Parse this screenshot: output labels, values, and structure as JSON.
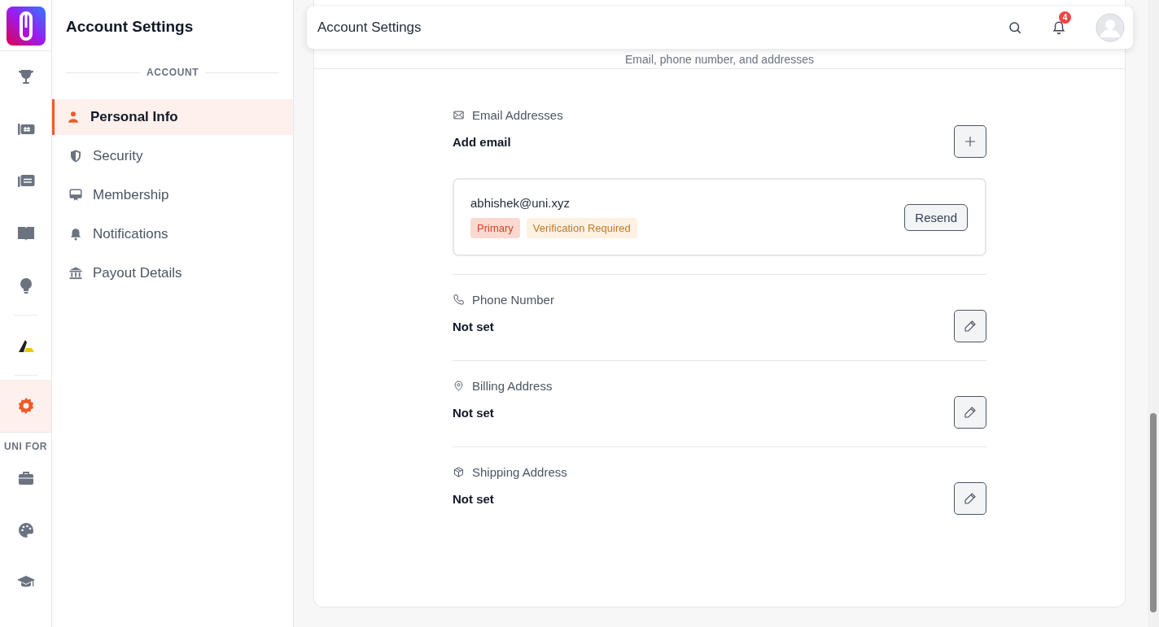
{
  "rail": {
    "items": [
      {
        "selected": false
      },
      {
        "selected": false
      },
      {
        "selected": false
      },
      {
        "selected": false
      },
      {
        "selected": false
      },
      {
        "selected": false
      },
      {
        "selected": true
      },
      {
        "selected": false
      },
      {
        "selected": false
      },
      {
        "selected": false
      }
    ],
    "section_label": "UNI FOR"
  },
  "sidebar": {
    "title": "Account Settings",
    "section": "ACCOUNT",
    "items": [
      {
        "label": "Personal Info",
        "kind": "person",
        "selected": true
      },
      {
        "label": "Security",
        "kind": "shield",
        "selected": false
      },
      {
        "label": "Membership",
        "kind": "certificate",
        "selected": false
      },
      {
        "label": "Notifications",
        "kind": "bell",
        "selected": false
      },
      {
        "label": "Payout Details",
        "kind": "bank",
        "selected": false
      }
    ]
  },
  "header": {
    "title": "Account Settings",
    "notification_count": "4"
  },
  "subtitle": "Email, phone number, and addresses",
  "sections": [
    {
      "kind": "email",
      "label": "Email Addresses",
      "add_label": "Add email",
      "emails": [
        {
          "address": "abhishek@uni.xyz",
          "tags": [
            {
              "label": "Primary",
              "kind": "primary"
            },
            {
              "label": "Verification Required",
              "kind": "warning"
            }
          ],
          "action": "Resend"
        }
      ]
    },
    {
      "kind": "phone",
      "label": "Phone Number",
      "value": "Not set"
    },
    {
      "kind": "billing",
      "label": "Billing Address",
      "value": "Not set"
    },
    {
      "kind": "shipping",
      "label": "Shipping Address",
      "value": "Not set"
    }
  ]
}
